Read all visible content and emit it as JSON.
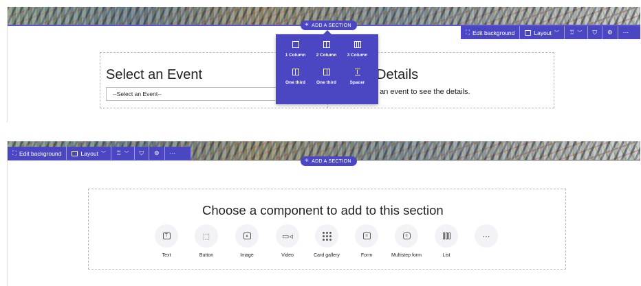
{
  "top_panel": {
    "add_section_label": "ADD A SECTION",
    "toolbar": {
      "edit_background": "Edit background",
      "layout": "Layout"
    },
    "layout_menu": {
      "items": [
        {
          "label": "1 Column",
          "icon": "one-column-icon"
        },
        {
          "label": "2 Column",
          "icon": "two-column-icon"
        },
        {
          "label": "3 Column",
          "icon": "three-column-icon"
        },
        {
          "label": "One third",
          "icon": "one-third-left-icon"
        },
        {
          "label": "One third",
          "icon": "one-third-right-icon"
        },
        {
          "label": "Spacer",
          "icon": "spacer-icon"
        }
      ]
    },
    "select_event": {
      "title": "Select an Event",
      "dropdown_value": "--Select an Event--"
    },
    "details": {
      "title": "Details",
      "text": "t an event to see the details."
    }
  },
  "bottom_panel": {
    "toolbar": {
      "edit_background": "Edit background",
      "layout": "Layout"
    },
    "add_section_label": "ADD A SECTION",
    "choose_title": "Choose a component to add to this section",
    "components": [
      {
        "label": "Text",
        "icon": "text-icon"
      },
      {
        "label": "Button",
        "icon": "button-icon"
      },
      {
        "label": "Image",
        "icon": "image-icon"
      },
      {
        "label": "Video",
        "icon": "video-icon"
      },
      {
        "label": "Card gallery",
        "icon": "card-gallery-icon"
      },
      {
        "label": "Form",
        "icon": "form-icon"
      },
      {
        "label": "Multistep form",
        "icon": "multistep-form-icon"
      },
      {
        "label": "List",
        "icon": "list-icon"
      },
      {
        "label": "",
        "icon": "more-icon"
      }
    ]
  },
  "colors": {
    "accent": "#4b47c2",
    "text": "#222222",
    "dashed_border": "#b8b8b8"
  }
}
